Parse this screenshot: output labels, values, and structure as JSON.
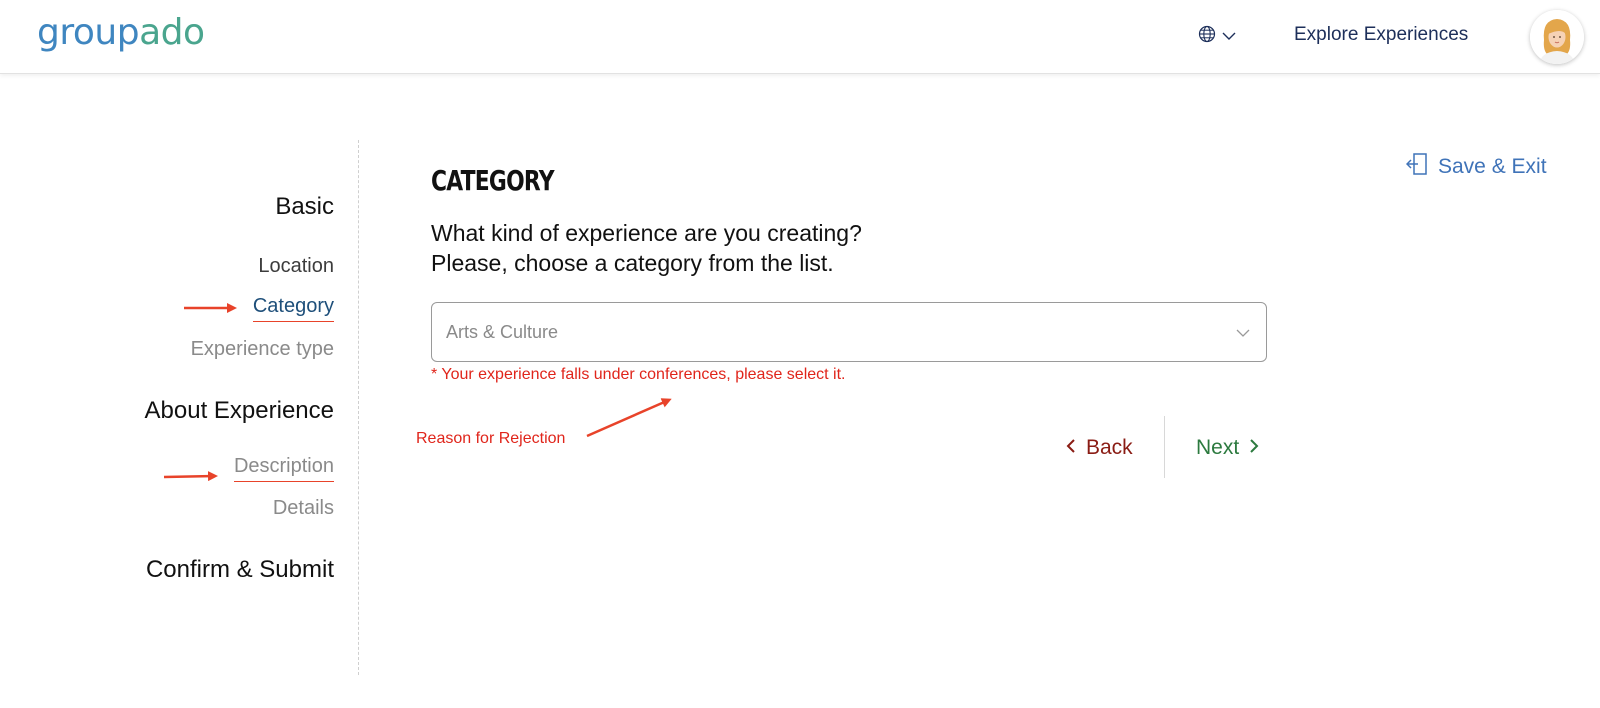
{
  "header": {
    "logo_part1": "group",
    "logo_part2": "ado",
    "explore_label": "Explore Experiences",
    "language_icon": "globe-icon"
  },
  "sidebar": {
    "sections": [
      {
        "label": "Basic",
        "items": [
          "Location",
          "Category",
          "Experience type"
        ]
      },
      {
        "label": "About Experience",
        "items": [
          "Description",
          "Details"
        ]
      },
      {
        "label": "Confirm & Submit",
        "items": []
      }
    ],
    "active_item": "Category"
  },
  "main": {
    "title": "CATEGORY",
    "question_line1": "What kind of experience are you creating?",
    "question_line2": "Please, choose a category from the list.",
    "select_value": "Arts & Culture",
    "error_text": "* Your experience falls under conferences, please select it.",
    "save_exit_label": "Save & Exit",
    "back_label": "Back",
    "next_label": "Next"
  },
  "annotations": {
    "rejection_label": "Reason for Rejection"
  },
  "colors": {
    "accent_blue": "#3f73b8",
    "error_red": "#e0251b",
    "back_color": "#8a1c14",
    "next_color": "#2c7a3f",
    "logo_blue": "#3f86c0",
    "logo_green": "#4aa58e"
  }
}
